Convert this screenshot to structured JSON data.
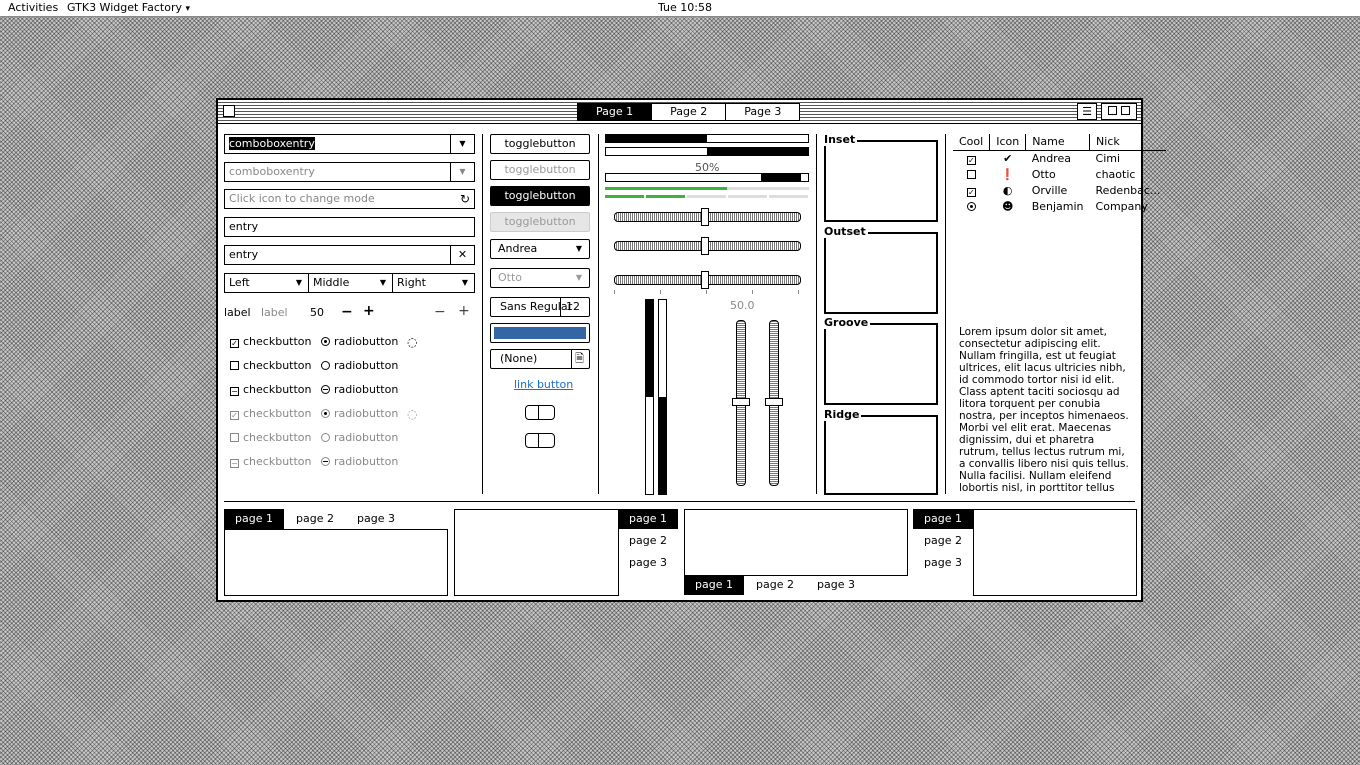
{
  "topbar": {
    "activities": "Activities",
    "app": "GTK3 Widget Factory",
    "app_arrow": "▾",
    "clock": "Tue 10:58"
  },
  "header": {
    "stack": [
      "Page 1",
      "Page 2",
      "Page 3"
    ],
    "menu_icon": "☰"
  },
  "col1": {
    "combo1": "comboboxentry",
    "combo2": "comboboxentry",
    "entry_icon_placeholder": "Click icon to change mode",
    "entry3": "entry",
    "entry4": "entry",
    "combos": [
      "Left",
      "Middle",
      "Right"
    ],
    "label1": "label",
    "label2": "label",
    "spin_value": "50",
    "minus": "−",
    "plus": "+",
    "checks": [
      "checkbutton",
      "checkbutton",
      "checkbutton",
      "checkbutton",
      "checkbutton",
      "checkbutton"
    ],
    "radios": [
      "radiobutton",
      "radiobutton",
      "radiobutton",
      "radiobutton",
      "radiobutton",
      "radiobutton"
    ]
  },
  "col2": {
    "toggles": [
      "togglebutton",
      "togglebutton",
      "togglebutton",
      "togglebutton"
    ],
    "combo_andrea": "Andrea",
    "combo_otto": "Otto",
    "font_name": "Sans Regular",
    "font_size": "12",
    "color": "#3465a4",
    "file_none": "(None)",
    "link": "link button"
  },
  "col3": {
    "progress_text": "50%",
    "progress_values": [
      0.5,
      0.5
    ],
    "scale_value": "50.0"
  },
  "frames": [
    "Inset",
    "Outset",
    "Groove",
    "Ridge"
  ],
  "tree": {
    "columns": [
      "Cool",
      "Icon",
      "Name",
      "Nick"
    ],
    "rows": [
      {
        "cool": "checked",
        "icon": "check-circle-icon",
        "name": "Andrea",
        "nick": "Cimi"
      },
      {
        "cool": "unchecked",
        "icon": "exclamation-icon",
        "name": "Otto",
        "nick": "chaotic"
      },
      {
        "cool": "checked",
        "icon": "half-moon-icon",
        "name": "Orville",
        "nick": "Redenbac..."
      },
      {
        "cool": "radio",
        "icon": "person-icon",
        "name": "Benjamin",
        "nick": "Company"
      }
    ]
  },
  "lorem": "Lorem ipsum dolor sit amet, consectetur adipiscing elit.\nNullam fringilla, est ut feugiat ultrices, elit lacus ultricies nibh, id commodo tortor nisi id elit.\nClass aptent taciti sociosqu ad litora torquent per conubia nostra, per inceptos himenaeos.\nMorbi vel elit erat. Maecenas dignissim, dui et pharetra rutrum, tellus lectus rutrum mi, a convallis libero nisi quis tellus.\nNulla facilisi. Nullam eleifend lobortis nisl, in porttitor tellus",
  "notebooks": {
    "tabs": [
      "page 1",
      "page 2",
      "page 3"
    ]
  }
}
